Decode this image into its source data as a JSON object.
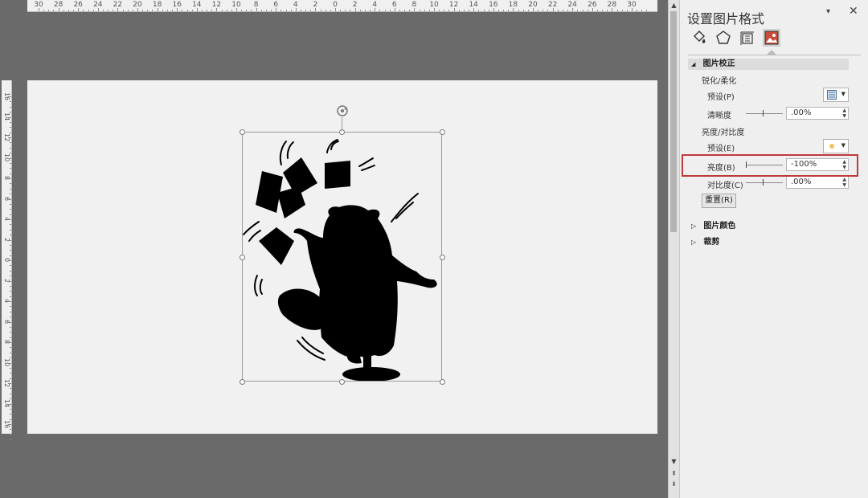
{
  "ruler": {
    "horizontal_labels": [
      "30",
      "28",
      "26",
      "24",
      "22",
      "20",
      "18",
      "16",
      "14",
      "12",
      "10",
      "8",
      "6",
      "4",
      "2",
      "0",
      "2",
      "4",
      "6",
      "8",
      "10",
      "12",
      "14",
      "16",
      "18",
      "20",
      "22",
      "24",
      "26",
      "28",
      "30"
    ],
    "vertical_labels": [
      "16",
      "14",
      "12",
      "10",
      "8",
      "6",
      "4",
      "2",
      "0",
      "2",
      "4",
      "6",
      "8",
      "10",
      "12",
      "14",
      "16"
    ]
  },
  "pane": {
    "title": "设置图片格式",
    "dropdown_glyph": "▾",
    "close_glyph": "✕",
    "tabs": [
      {
        "name": "fill-line",
        "icon": "paint-bucket-icon"
      },
      {
        "name": "effects",
        "icon": "pentagon-icon"
      },
      {
        "name": "size-properties",
        "icon": "size-properties-icon"
      },
      {
        "name": "picture",
        "icon": "picture-icon",
        "selected": true
      }
    ],
    "section_picture_correction": {
      "label": "图片校正",
      "collapse_glyph": "◢",
      "sharpen_soften_label": "锐化/柔化",
      "preset_label": "预设(P)",
      "clarity_label": "清晰度",
      "clarity_value": ".00%",
      "brightness_contrast_label": "亮度/对比度",
      "preset2_label": "预设(E)",
      "brightness_label": "亮度(B)",
      "brightness_value": "-100%",
      "contrast_label": "对比度(C)",
      "contrast_value": ".00%",
      "reset_label": "重置(R)"
    },
    "section_picture_color": {
      "label": "图片颜色",
      "glyph": "▷"
    },
    "section_crop": {
      "label": "裁剪",
      "glyph": "▷"
    }
  },
  "colors": {
    "highlight": "#c0393b",
    "pane_bg": "#efefef",
    "editor_bg": "#6a6a6a",
    "slide_bg": "#f1f1f1"
  },
  "image": {
    "content": "black silhouette of a beaver juggling cards"
  }
}
